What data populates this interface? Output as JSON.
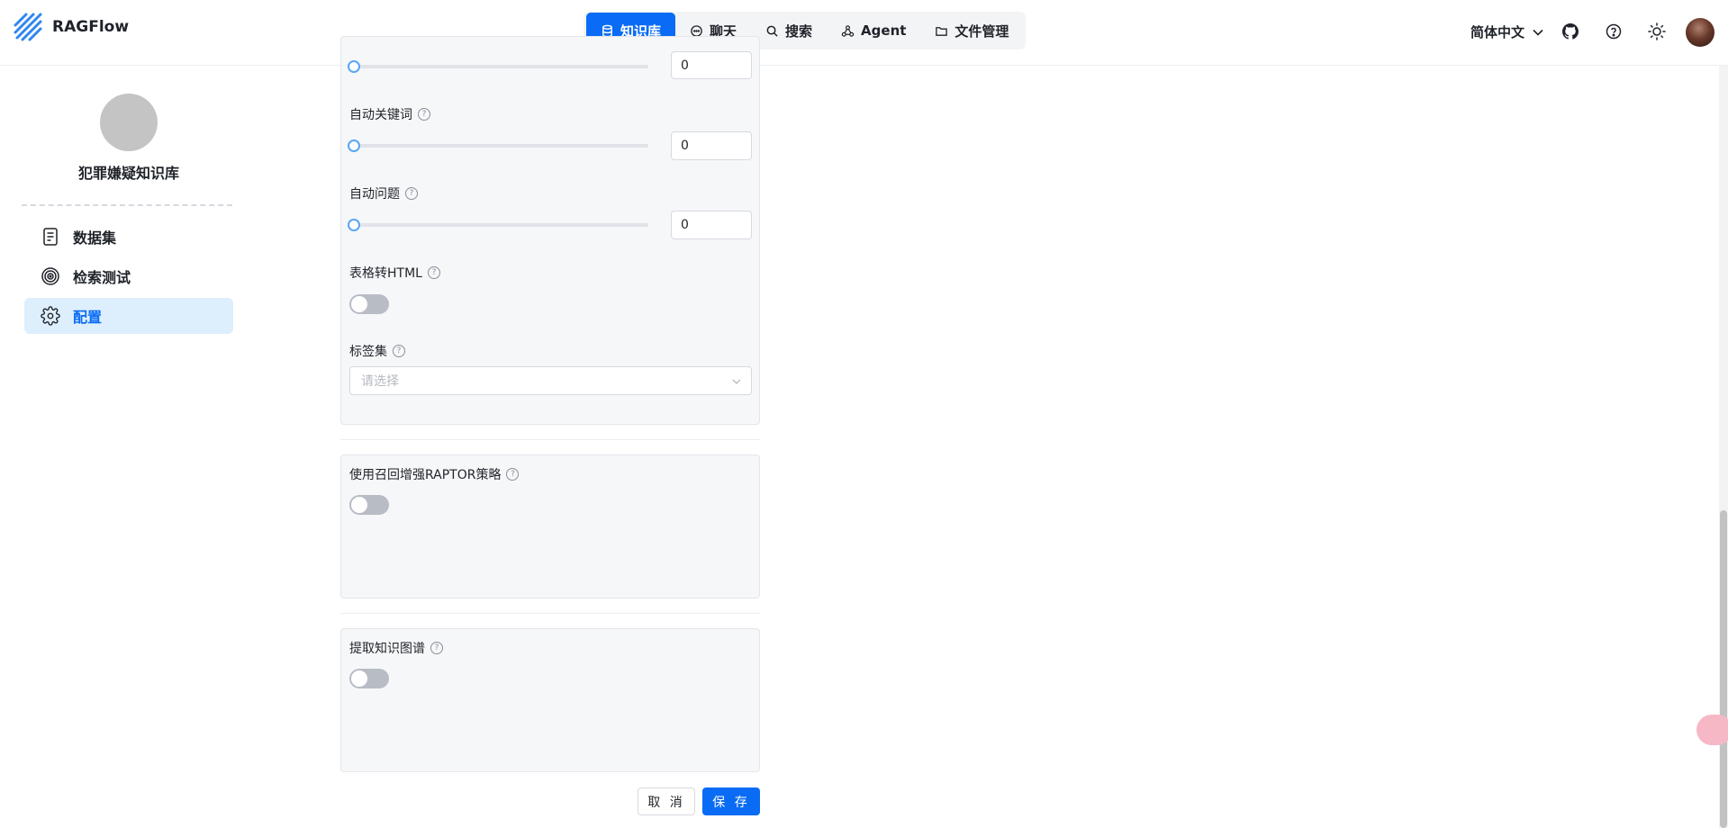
{
  "app": {
    "brand": "RAGFlow"
  },
  "nav": [
    {
      "label": "知识库",
      "icon": "database-icon",
      "active": true
    },
    {
      "label": "聊天",
      "icon": "chat-icon",
      "active": false
    },
    {
      "label": "搜索",
      "icon": "search-icon",
      "active": false
    },
    {
      "label": "Agent",
      "icon": "agent-icon",
      "active": false
    },
    {
      "label": "文件管理",
      "icon": "folder-icon",
      "active": false
    }
  ],
  "header": {
    "language": "简体中文"
  },
  "sidebar": {
    "kb_name": "犯罪嫌疑知识库",
    "items": [
      {
        "label": "数据集",
        "icon": "document-icon"
      },
      {
        "label": "检索测试",
        "icon": "target-icon"
      },
      {
        "label": "配置",
        "icon": "gear-icon"
      }
    ]
  },
  "form": {
    "top_partial_value": "0",
    "auto_keywords": {
      "label": "自动关键词",
      "value": "0"
    },
    "auto_questions": {
      "label": "自动问题",
      "value": "0"
    },
    "table_to_html": {
      "label": "表格转HTML",
      "enabled": false
    },
    "tag_set": {
      "label": "标签集",
      "placeholder": "请选择"
    },
    "raptor": {
      "label": "使用召回增强RAPTOR策略",
      "enabled": false
    },
    "knowledge_graph": {
      "label": "提取知识图谱",
      "enabled": false
    }
  },
  "actions": {
    "cancel": "取 消",
    "save": "保 存"
  },
  "colors": {
    "primary": "#0a6cf5",
    "active_bg": "#ddeefd",
    "panel_bg": "#f6f7f9"
  }
}
